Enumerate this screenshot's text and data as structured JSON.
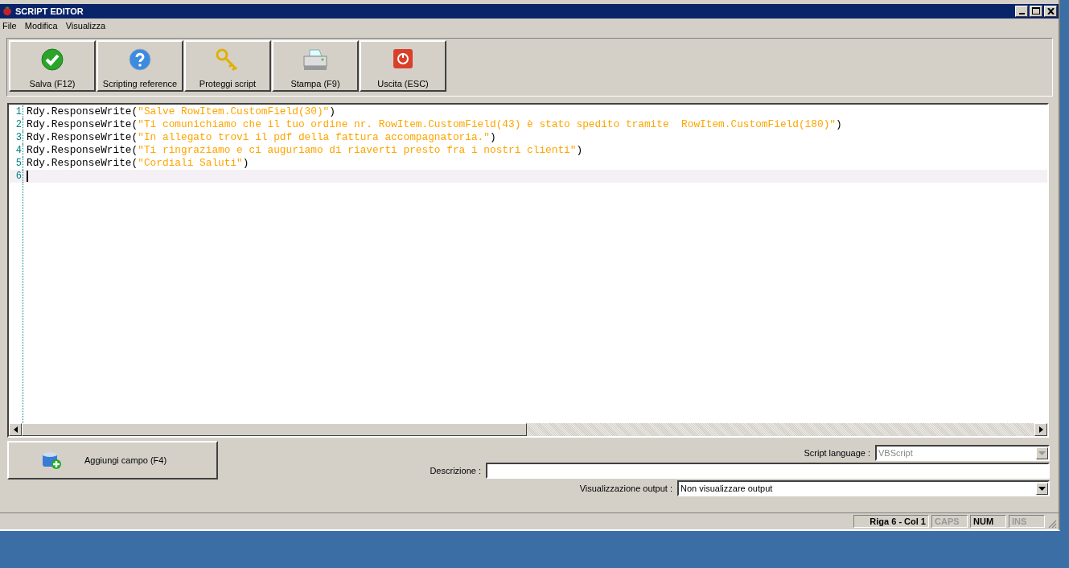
{
  "window": {
    "title": "SCRIPT EDITOR"
  },
  "menu": [
    "File",
    "Modifica",
    "Visualizza"
  ],
  "toolbar": [
    {
      "label": "Salva (F12)",
      "kind": "check"
    },
    {
      "label": "Scripting reference",
      "kind": "help"
    },
    {
      "label": "Proteggi script",
      "kind": "key"
    },
    {
      "label": "Stampa (F9)",
      "kind": "printer"
    },
    {
      "label": "Uscita (ESC)",
      "kind": "power"
    }
  ],
  "editor": {
    "lines": [
      {
        "number": "1",
        "code": "Rdy.ResponseWrite(",
        "string": "\"Salve RowItem.CustomField(30)\"",
        "end": ")",
        "current": false
      },
      {
        "number": "2",
        "code": "Rdy.ResponseWrite(",
        "string": "\"Ti comunichiamo che il tuo ordine nr. RowItem.CustomField(43) è stato spedito tramite  RowItem.CustomField(180)\"",
        "end": ")",
        "current": false
      },
      {
        "number": "3",
        "code": "Rdy.ResponseWrite(",
        "string": "\"In allegato trovi il pdf della fattura accompagnatoria.\"",
        "end": ")",
        "current": false
      },
      {
        "number": "4",
        "code": "Rdy.ResponseWrite(",
        "string": "\"Ti ringraziamo e ci auguriamo di riaverti presto fra i nostri clienti\"",
        "end": ")",
        "current": false
      },
      {
        "number": "5",
        "code": "Rdy.ResponseWrite(",
        "string": "\"Cordiali Saluti\"",
        "end": ")",
        "current": false
      },
      {
        "number": "6",
        "current": true
      }
    ]
  },
  "add_field_button": {
    "label": "Aggiungi campo (F4)"
  },
  "script_language": {
    "label": "Script language :",
    "value": "VBScript",
    "disabled": true
  },
  "description": {
    "label": "Descrizione :"
  },
  "output": {
    "label": "Visualizzazione output :",
    "value": "Non visualizzare output",
    "disabled": false
  },
  "status_bar": {
    "position": "Riga 6 - Col 1",
    "indicators": [
      {
        "label": "CAPS",
        "active": false
      },
      {
        "label": "NUM",
        "active": true
      },
      {
        "label": "INS",
        "active": false
      }
    ]
  }
}
